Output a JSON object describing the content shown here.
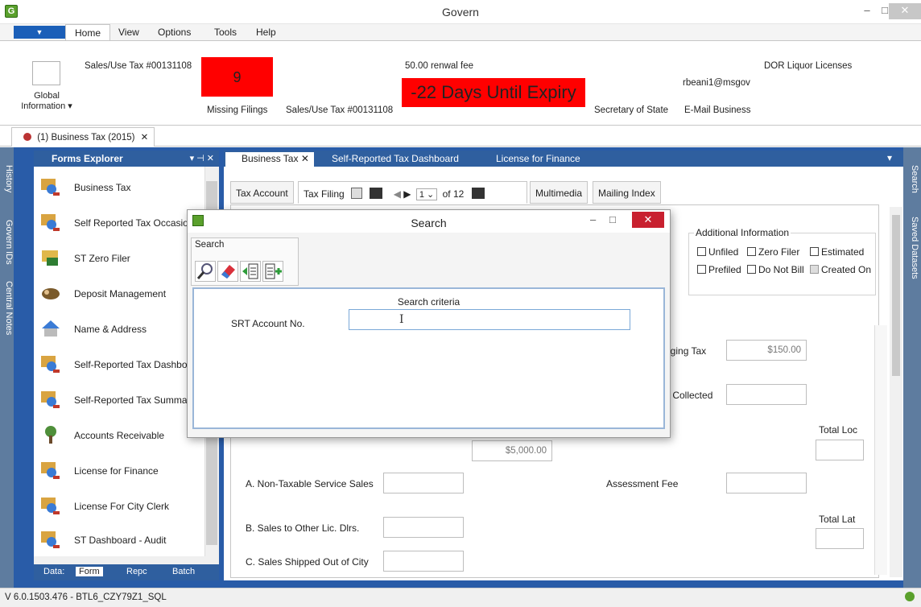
{
  "window": {
    "title": "Govern",
    "minimize_label": "–",
    "maximize_label": "□",
    "close_label": "✕"
  },
  "ribbon": {
    "file_menu_label": "▼",
    "tabs": [
      {
        "label": "Home"
      },
      {
        "label": "View"
      },
      {
        "label": "Options"
      },
      {
        "label": "Tools"
      },
      {
        "label": "Help"
      }
    ],
    "global_info_label": "Global Information ▾",
    "sales_tax_top": "Sales/Use Tax #00131108",
    "missing_filings_count": "9",
    "missing_filings_label": "Missing Filings",
    "sales_tax_bottom": "Sales/Use Tax #00131108",
    "renewal_fee": "50.00 renwal fee",
    "expiry_text": "-22 Days Until Expiry",
    "email_text": "rbeani1@msgov",
    "secretary_of_state": "Secretary of State",
    "email_business": "E-Mail Business",
    "dor_liquor": "DOR Liquor Licenses"
  },
  "doc_tab": {
    "label": "(1) Business Tax (2015)",
    "close_label": "✕"
  },
  "left_rail": [
    "History",
    "Govern IDs",
    "Central Notes"
  ],
  "right_rail": [
    "Search",
    "Saved Datasets"
  ],
  "forms_explorer": {
    "title": "Forms Explorer",
    "pin_label": "▾ ⊣ ✕",
    "items": [
      {
        "label": "Business Tax"
      },
      {
        "label": "Self Reported Tax Occasion"
      },
      {
        "label": "ST Zero Filer"
      },
      {
        "label": "Deposit Management"
      },
      {
        "label": "Name & Address"
      },
      {
        "label": "Self-Reported Tax Dashboa"
      },
      {
        "label": "Self-Reported Tax Summar"
      },
      {
        "label": "Accounts Receivable"
      },
      {
        "label": "License for Finance"
      },
      {
        "label": "License For City Clerk"
      },
      {
        "label": "ST Dashboard - Audit"
      }
    ],
    "bottom_tabs": [
      {
        "label": "Data:"
      },
      {
        "label": "Form"
      },
      {
        "label": "Repc"
      },
      {
        "label": "Batch"
      }
    ]
  },
  "main_tabs": [
    {
      "label": "Business Tax ✕"
    },
    {
      "label": "Self-Reported Tax Dashboard"
    },
    {
      "label": "License for Finance"
    }
  ],
  "sub_tabs": {
    "tax_account": "Tax Account",
    "tax_filing": "Tax Filing",
    "page_value": "1",
    "page_of": "of 12",
    "multimedia": "Multimedia",
    "mailing_index": "Mailing Index"
  },
  "additional_info": {
    "title": "Additional Information",
    "unfiled": "Unfiled",
    "zero_filer": "Zero Filer",
    "estimated": "Estimated",
    "prefiled": "Prefiled",
    "do_not_bill": "Do Not Bill",
    "created_on": "Created On"
  },
  "form_fields": {
    "lodging_tax_label": "dging Tax",
    "lodging_tax_value": "$150.00",
    "collected_label": "c Collected",
    "total_loc_label": "Total Loc",
    "amount_5000": "$5,000.00",
    "non_taxable_label": "A. Non-Taxable Service Sales",
    "assessment_fee_label": "Assessment Fee",
    "total_late_label": "Total Lat",
    "sales_other_label": "B. Sales to Other Lic. Dlrs.",
    "shipped_out_label": "C. Sales Shipped Out of City"
  },
  "search_dialog": {
    "title": "Search",
    "group_label": "Search",
    "criteria_title": "Search criteria",
    "srt_label": "SRT Account No.",
    "srt_value": "",
    "cursor_glyph": "I"
  },
  "status_bar": {
    "version": "V 6.0.1503.476 - BTL6_CZY79Z1_SQL"
  }
}
